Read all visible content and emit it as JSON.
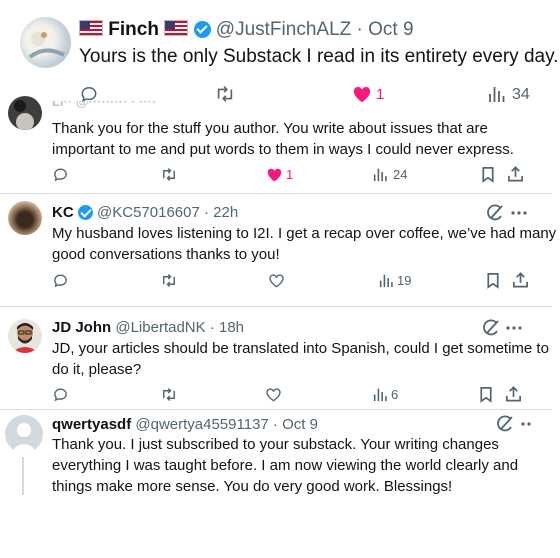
{
  "main_tweet": {
    "display_name": "Finch",
    "handle": "@JustFinchALZ",
    "date": "Oct 9",
    "text": "Yours is the only Substack I read in its entirety every day.",
    "likes": "1",
    "views": "34"
  },
  "replies": [
    {
      "display_name": "",
      "handle": "",
      "time": "",
      "text_line1": "Thank you for the stuff you author. You write about issues that are",
      "text_line2": "important to me and put words to them in ways I could never express.",
      "likes": "1",
      "views": "24"
    },
    {
      "display_name": "KC",
      "handle": "@KC57016607",
      "time": "22h",
      "text_line1": "My husband loves listening to I2I. I get a recap over coffee, we’ve had many",
      "text_line2": "good conversations thanks to you!",
      "views": "19"
    },
    {
      "display_name": "JD John",
      "handle": "@LibertadNK",
      "time": "18h",
      "text_line1": "JD, your articles should be translated into Spanish, could I get sometime to",
      "text_line2": "do it, please?",
      "views": "6"
    },
    {
      "display_name": "qwertyasdf",
      "handle": "@qwertya45591137",
      "time": "Oct 9",
      "text_line1": "Thank you.  I just subscribed to your substack.  Your writing changes",
      "text_line2": "everything I was taught before.  I am now viewing the world clearly and",
      "text_line3": "things make more sense.  You do very good work.  Blessings!"
    }
  ],
  "separator": "·",
  "colors": {
    "like_pink": "#f91880",
    "verified_blue": "#1d9bf0",
    "muted_gray": "#536471",
    "divider": "#d9dde1"
  },
  "icons": [
    "reply-icon",
    "retweet-icon",
    "like-icon",
    "views-icon",
    "bookmark-icon",
    "share-icon",
    "grok-icon",
    "more-icon",
    "verified-badge-icon",
    "us-flag-icon"
  ]
}
